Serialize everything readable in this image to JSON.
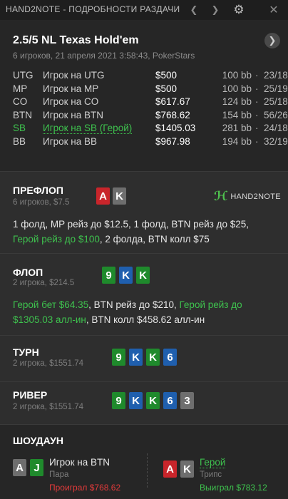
{
  "window": {
    "title": "HAND2NOTE - ПОДРОБНОСТИ РАЗДАЧИ",
    "icons": [
      "chevron-left-icon",
      "chevron-right-icon",
      "gear-icon",
      "close-icon"
    ]
  },
  "hand": {
    "title": "2.5/5 NL Texas Hold'em",
    "subtitle": "6 игроков, 21 апреля 2021 3:58:43, PokerStars"
  },
  "players": [
    {
      "pos": "UTG",
      "name": "Игрок на UTG",
      "stack": "$500",
      "bb": "100 bb",
      "stat": "23/18",
      "hero": false
    },
    {
      "pos": "MP",
      "name": "Игрок на MP",
      "stack": "$500",
      "bb": "100 bb",
      "stat": "25/19",
      "hero": false
    },
    {
      "pos": "CO",
      "name": "Игрок на CO",
      "stack": "$617.67",
      "bb": "124 bb",
      "stat": "25/18",
      "hero": false
    },
    {
      "pos": "BTN",
      "name": "Игрок на BTN",
      "stack": "$768.62",
      "bb": "154 bb",
      "stat": "56/26",
      "hero": false
    },
    {
      "pos": "SB",
      "name": "Игрок на SB (Герой)",
      "stack": "$1405.03",
      "bb": "281 bb",
      "stat": "24/18",
      "hero": true
    },
    {
      "pos": "BB",
      "name": "Игрок на BB",
      "stack": "$967.98",
      "bb": "194 bb",
      "stat": "32/19",
      "hero": false
    }
  ],
  "streets": {
    "preflop": {
      "title": "ПРЕФЛОП",
      "sub": "6 игроков, $7.5",
      "cards": [
        "A",
        "K"
      ],
      "actions": [
        {
          "t": "1 фолд, MP рейз до $12.5, 1 фолд, BTN рейз до $25, ",
          "hero": false
        },
        {
          "t": "Герой рейз до $100",
          "hero": true
        },
        {
          "t": ", 2 фолда, BTN колл $75",
          "hero": false
        }
      ]
    },
    "flop": {
      "title": "ФЛОП",
      "sub": "2 игрока, $214.5",
      "cards": [
        "9",
        "K",
        "K"
      ],
      "actions": [
        {
          "t": "Герой бет $64.35",
          "hero": true
        },
        {
          "t": ", BTN рейз до $210, ",
          "hero": false
        },
        {
          "t": "Герой рейз до $1305.03 алл-ин",
          "hero": true
        },
        {
          "t": ", BTN колл $458.62 алл-ин",
          "hero": false
        }
      ]
    },
    "turn": {
      "title": "ТУРН",
      "sub": "2 игрока, $1551.74",
      "cards": [
        "9",
        "K",
        "K",
        "6"
      ]
    },
    "river": {
      "title": "РИВЕР",
      "sub": "2 игрока, $1551.74",
      "cards": [
        "9",
        "K",
        "K",
        "6",
        "3"
      ]
    }
  },
  "logo": {
    "text": "HAND2NOTE"
  },
  "showdown": {
    "title": "ШОУДАУН",
    "villain": {
      "cards": [
        "A",
        "J"
      ],
      "name": "Игрок на BTN",
      "hand": "Пара",
      "result": "Проиграл $768.62"
    },
    "hero": {
      "cards": [
        "A",
        "K"
      ],
      "name": "Герой",
      "hand": "Трипс",
      "result": "Выиграл $783.12"
    }
  },
  "colors": {
    "hero": "#3ec24e",
    "loss": "#e03a3a",
    "hearts": "#c9252b",
    "clubs": "#1f8a2c",
    "diamonds": "#1f5fae",
    "spades": "#6e6e6e"
  }
}
